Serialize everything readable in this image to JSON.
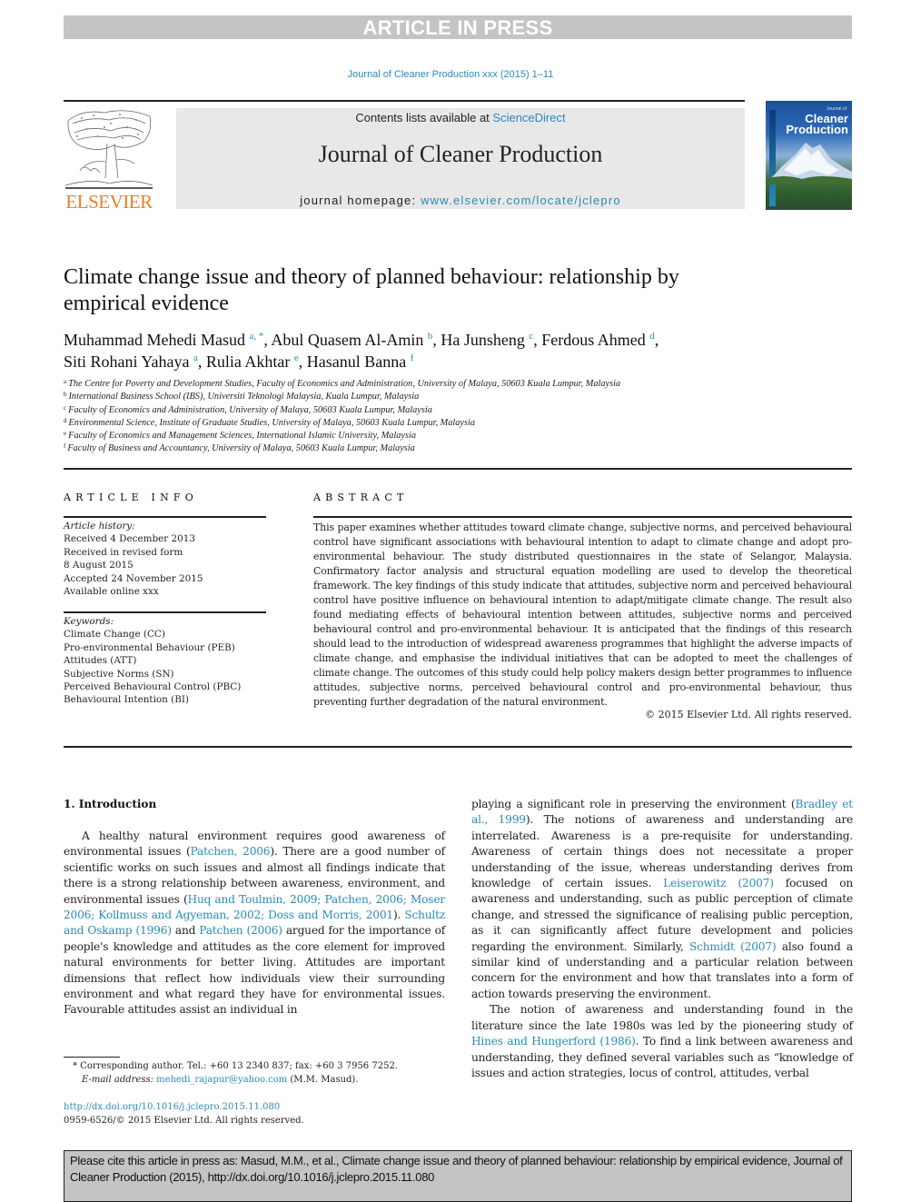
{
  "banner": {
    "text": "ARTICLE IN PRESS"
  },
  "journal_ref": "Journal of Cleaner Production xxx (2015) 1–11",
  "publisher": {
    "logo_text": "ELSEVIER"
  },
  "masthead": {
    "contents_prefix": "Contents lists available at ",
    "contents_link": "ScienceDirect",
    "journal_title": "Journal of Cleaner Production",
    "homepage_prefix": "journal homepage: ",
    "homepage_link": "www.elsevier.com/locate/jclepro"
  },
  "cover": {
    "small_text": "Journal of",
    "title_line1": "Cleaner",
    "title_line2": "Production"
  },
  "article": {
    "title": "Climate change issue and theory of planned behaviour: relationship by empirical evidence",
    "authors": [
      {
        "name": "Muhammad Mehedi Masud",
        "sup": "a, *"
      },
      {
        "name": "Abul Quasem Al-Amin",
        "sup": "b"
      },
      {
        "name": "Ha Junsheng",
        "sup": "c"
      },
      {
        "name": "Ferdous Ahmed",
        "sup": "d"
      },
      {
        "name": "Siti Rohani Yahaya",
        "sup": "a"
      },
      {
        "name": "Rulia Akhtar",
        "sup": "e"
      },
      {
        "name": "Hasanul Banna",
        "sup": "f"
      }
    ],
    "affiliations": [
      {
        "key": "a",
        "text": "The Centre for Poverty and Development Studies, Faculty of Economics and Administration, University of Malaya, 50603 Kuala Lumpur, Malaysia"
      },
      {
        "key": "b",
        "text": "International Business School (IBS), Universiti Teknologi Malaysia, Kuala Lumpur, Malaysia"
      },
      {
        "key": "c",
        "text": "Faculty of Economics and Administration, University of Malaya, 50603 Kuala Lumpur, Malaysia"
      },
      {
        "key": "d",
        "text": "Environmental Science, Institute of Graduate Studies, University of Malaya, 50603 Kuala Lumpur, Malaysia"
      },
      {
        "key": "e",
        "text": "Faculty of Economics and Management Sciences, International Islamic University, Malaysia"
      },
      {
        "key": "f",
        "text": "Faculty of Business and Accountancy, University of Malaya, 50603 Kuala Lumpur, Malaysia"
      }
    ]
  },
  "article_info": {
    "heading": "ARTICLE INFO",
    "history_label": "Article history:",
    "history": [
      "Received 4 December 2013",
      "Received in revised form",
      "8 August 2015",
      "Accepted 24 November 2015",
      "Available online xxx"
    ],
    "keywords_label": "Keywords:",
    "keywords": [
      "Climate Change (CC)",
      "Pro-environmental Behaviour (PEB)",
      "Attitudes (ATT)",
      "Subjective Norms (SN)",
      "Perceived Behavioural Control (PBC)",
      "Behavioural Intention (BI)"
    ]
  },
  "abstract": {
    "heading": "ABSTRACT",
    "text": "This paper examines whether attitudes toward climate change, subjective norms, and perceived behavioural control have significant associations with behavioural intention to adapt to climate change and adopt pro-environmental behaviour. The study distributed questionnaires in the state of Selangor, Malaysia. Confirmatory factor analysis and structural equation modelling are used to develop the theoretical framework. The key findings of this study indicate that attitudes, subjective norm and perceived behavioural control have positive influence on behavioural intention to adapt/mitigate climate change. The result also found mediating effects of behavioural intention between attitudes, subjective norms and perceived behavioural control and pro-environmental behaviour. It is anticipated that the findings of this research should lead to the introduction of widespread awareness programmes that highlight the adverse impacts of climate change, and emphasise the individual initiatives that can be adopted to meet the challenges of climate change. The outcomes of this study could help policy makers design better programmes to influence attitudes, subjective norms, perceived behavioural control and pro-environmental behaviour, thus preventing further degradation of the natural environment.",
    "copyright": "© 2015 Elsevier Ltd. All rights reserved."
  },
  "introduction": {
    "heading": "1.  Introduction",
    "left_column": [
      {
        "t": "A healthy natural environment requires good awareness of environmental issues ("
      },
      {
        "l": "Patchen, 2006"
      },
      {
        "t": "). There are a good number of scientific works on such issues and almost all findings indicate that there is a strong relationship between awareness, environment, and environmental issues ("
      },
      {
        "l": "Huq and Toulmin, 2009; Patchen, 2006; Moser 2006; Kollmuss and Agyeman, 2002; Doss and Morris, 2001"
      },
      {
        "t": "). "
      },
      {
        "l": "Schultz and Oskamp (1996)"
      },
      {
        "t": " and "
      },
      {
        "l": "Patchen (2006)"
      },
      {
        "t": " argued for the importance of people's knowledge and attitudes as the core element for improved natural environments for better living. Attitudes are important dimensions that reflect how individuals view their surrounding environment and what regard they have for environmental issues. Favourable attitudes assist an individual in"
      }
    ],
    "right_para1": [
      {
        "t": "playing a significant role in preserving the environment ("
      },
      {
        "l": "Bradley et al., 1999"
      },
      {
        "t": "). The notions of awareness and understanding are interrelated. Awareness is a pre-requisite for understanding. Awareness of certain things does not necessitate a proper understanding of the issue, whereas understanding derives from knowledge of certain issues. "
      },
      {
        "l": "Leiserowitz (2007)"
      },
      {
        "t": " focused on awareness and understanding, such as public perception of climate change, and stressed the significance of realising public perception, as it can significantly affect future development and policies regarding the environment. Similarly, "
      },
      {
        "l": "Schmidt (2007)"
      },
      {
        "t": " also found a similar kind of understanding and a particular relation between concern for the environment and how that translates into a form of action towards preserving the environment."
      }
    ],
    "right_para2": [
      {
        "t": "The notion of awareness and understanding found in the literature since the late 1980s was led by the pioneering study of "
      },
      {
        "l": "Hines and Hungerford (1986)"
      },
      {
        "t": ". To find a link between awareness and understanding, they defined several variables such as “knowledge of issues and action strategies, locus of control, attitudes, verbal"
      }
    ]
  },
  "footnotes": {
    "corresponding": "*  Corresponding author. Tel.: +60 13 2340 837; fax: +60 3 7956 7252.",
    "email_label": "E-mail address:",
    "email": "mehedi_rajapur@yahoo.com",
    "email_suffix": " (M.M. Masud).",
    "doi_link": "http://dx.doi.org/10.1016/j.jclepro.2015.11.080",
    "issn_line": "0959-6526/© 2015 Elsevier Ltd. All rights reserved."
  },
  "citation_box": {
    "text": "Please cite this article in press as: Masud, M.M., et al., Climate change issue and theory of planned behaviour: relationship by empirical evidence, Journal of Cleaner Production (2015), http://dx.doi.org/10.1016/j.jclepro.2015.11.080"
  },
  "colors": {
    "link": "#2a8ab8",
    "elsevier_orange": "#f07c22",
    "banner_gray": "#c4c4c4",
    "masthead_gray": "#e8e8e8"
  }
}
